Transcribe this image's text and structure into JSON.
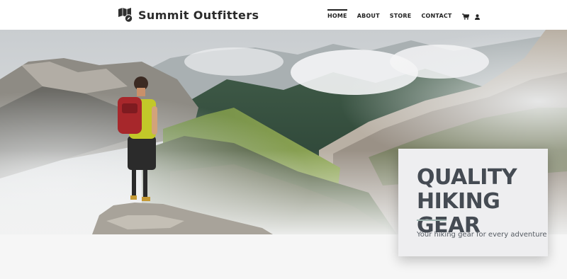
{
  "header": {
    "brand": "Summit Outfitters",
    "logo_icon": "folded-map-compass-icon"
  },
  "nav": {
    "items": [
      {
        "label": "HOME",
        "active": true
      },
      {
        "label": "ABOUT",
        "active": false
      },
      {
        "label": "STORE",
        "active": false
      },
      {
        "label": "CONTACT",
        "active": false
      }
    ],
    "cart_icon": "shopping-cart-icon",
    "account_icon": "user-icon"
  },
  "hero": {
    "image": "hiker-on-mountain-ridge-photo",
    "card": {
      "title_line1": "QUALITY",
      "title_line2": "HIKING GEAR",
      "subtitle": "Your hiking gear for every adventure"
    }
  },
  "colors": {
    "header_bg": "#ffffff",
    "text_dark": "#2b2b2b",
    "card_bg": "#eeeef0",
    "card_title": "#454b53",
    "accent_rule": "#9fb4b0",
    "page_bg": "#f6f6f6"
  }
}
